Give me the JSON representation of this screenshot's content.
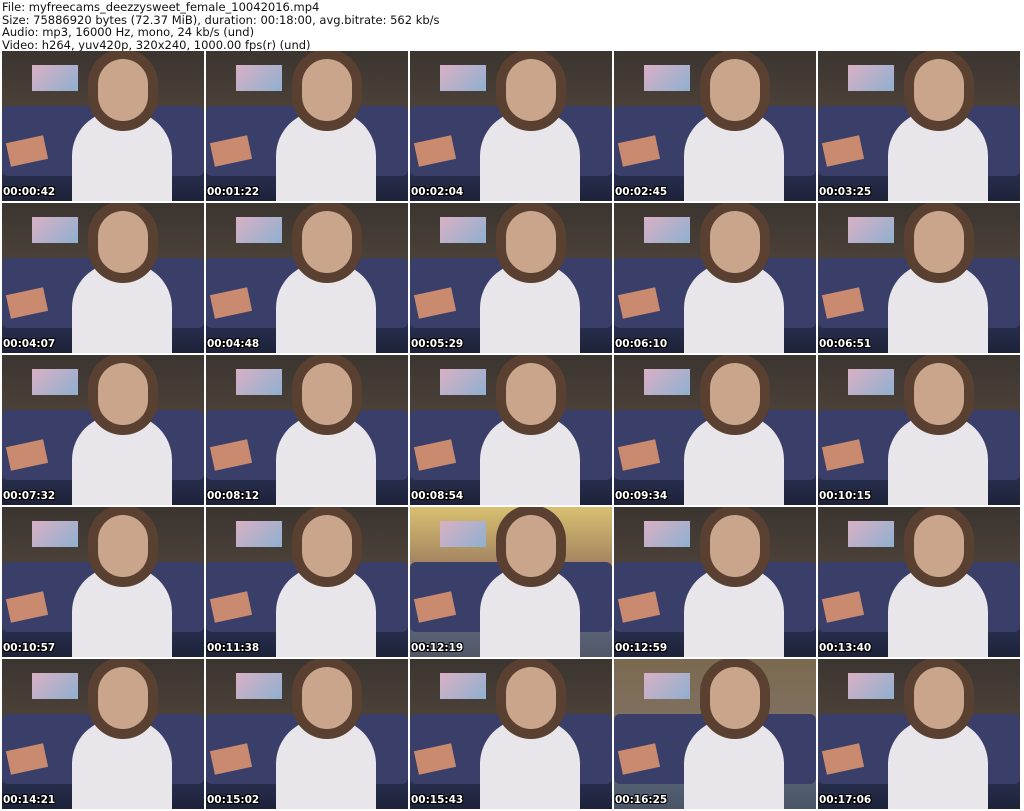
{
  "header": {
    "file": "File: myfreecams_deezzysweet_female_10042016.mp4",
    "size": "Size: 75886920 bytes (72.37 MiB), duration: 00:18:00, avg.bitrate: 562 kb/s",
    "audio": "Audio: mp3, 16000 Hz, mono, 24 kb/s (und)",
    "video": "Video: h264, yuv420p, 320x240, 1000.00 fps(r) (und)"
  },
  "thumbnails": [
    {
      "time": "00:00:42"
    },
    {
      "time": "00:01:22"
    },
    {
      "time": "00:02:04"
    },
    {
      "time": "00:02:45"
    },
    {
      "time": "00:03:25"
    },
    {
      "time": "00:04:07"
    },
    {
      "time": "00:04:48"
    },
    {
      "time": "00:05:29"
    },
    {
      "time": "00:06:10"
    },
    {
      "time": "00:06:51"
    },
    {
      "time": "00:07:32"
    },
    {
      "time": "00:08:12"
    },
    {
      "time": "00:08:54"
    },
    {
      "time": "00:09:34"
    },
    {
      "time": "00:10:15"
    },
    {
      "time": "00:10:57"
    },
    {
      "time": "00:11:38"
    },
    {
      "time": "00:12:19"
    },
    {
      "time": "00:12:59"
    },
    {
      "time": "00:13:40"
    },
    {
      "time": "00:14:21"
    },
    {
      "time": "00:15:02"
    },
    {
      "time": "00:15:43"
    },
    {
      "time": "00:16:25"
    },
    {
      "time": "00:17:06"
    }
  ]
}
